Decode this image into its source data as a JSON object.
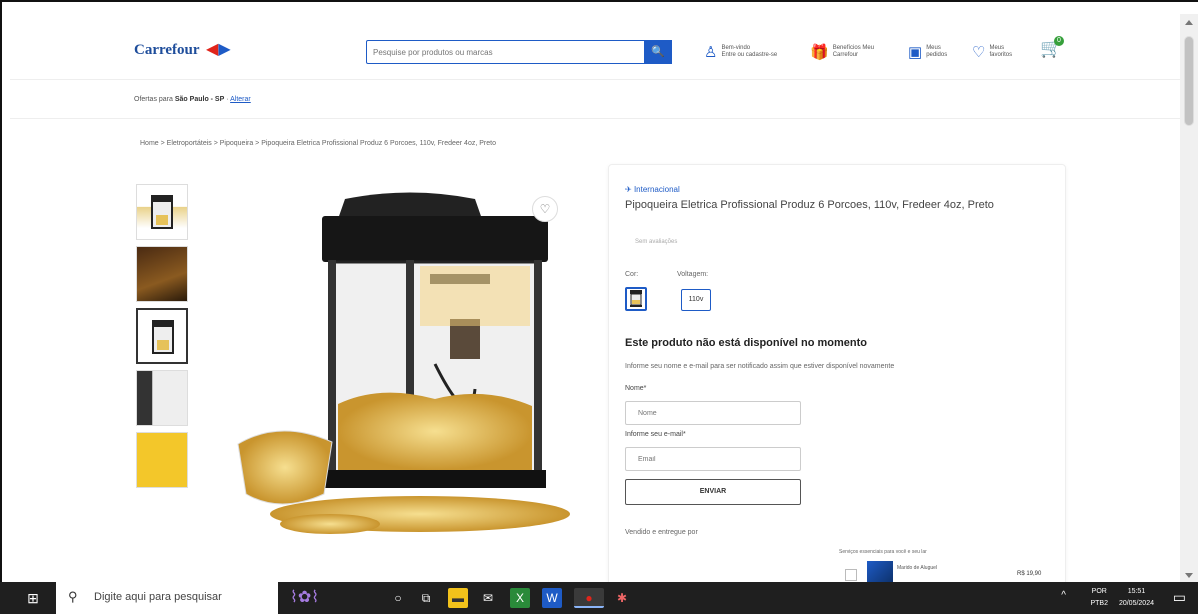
{
  "header": {
    "logo_text": "Carrefour",
    "search_placeholder": "Pesquise por produtos ou marcas",
    "login_line1": "Bem-vindo",
    "login_line2": "Entre ou cadastre-se",
    "benefits_line1": "Benefícios Meu",
    "benefits_line2": "Carrefour",
    "orders_line1": "Meus",
    "orders_line2": "pedidos",
    "favorites_line1": "Meus",
    "favorites_line2": "favoritos",
    "cart_count": "0"
  },
  "location": {
    "prefix": "Ofertas para",
    "city": "São Paulo - SP",
    "change_link": "Alterar"
  },
  "breadcrumb": "Home > Eletroportáteis > Pipoqueira > Pipoqueira Eletrica Profissional Produz 6 Porcoes, 110v, Fredeer 4oz, Preto",
  "product": {
    "badge": "Internacional",
    "title": "Pipoqueira Eletrica Profissional Produz 6 Porcoes, 110v, Fredeer 4oz, Preto",
    "seller_note": "Sem avaliações",
    "color_label": "Cor:",
    "voltage_label": "Voltagem:",
    "voltage_value": "110v",
    "unavailable_title": "Este produto não está disponível no momento",
    "notify_text": "Informe seu nome e e-mail para ser notificado assim que estiver disponível novamente",
    "name_label": "Nome*",
    "name_placeholder": "Nome",
    "email_label": "Informe seu e-mail*",
    "email_placeholder": "Email",
    "send_button": "ENVIAR",
    "sold_by": "Vendido e entregue por",
    "services_title": "Serviços essenciais para você e seu lar",
    "service_name": "Marido de Aluguel",
    "service_price": "R$ 19,90"
  },
  "taskbar": {
    "search_text": "Digite aqui para pesquisar",
    "lang": "POR",
    "lang2": "PTB2",
    "time": "15:51",
    "date": "20/05/2024"
  }
}
